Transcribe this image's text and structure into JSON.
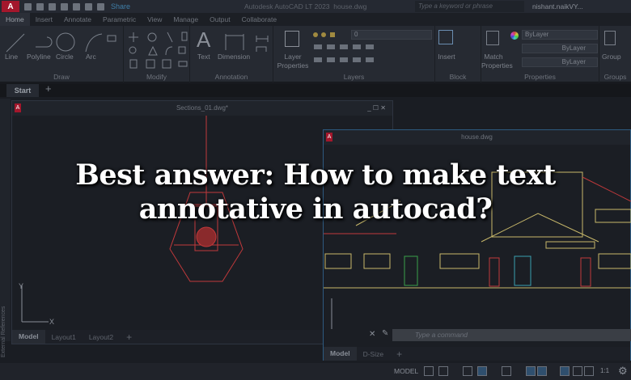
{
  "titlebar": {
    "logo": "A",
    "logo_badge": "LT",
    "share": "Share",
    "app_title": "Autodesk AutoCAD LT 2023",
    "file": "house.dwg",
    "search_placeholder": "Type a keyword or phrase",
    "user": "nishant.naikVY..."
  },
  "ribbon_tabs": [
    "Home",
    "Insert",
    "Annotate",
    "Parametric",
    "View",
    "Manage",
    "Output",
    "Collaborate"
  ],
  "panels": {
    "draw": {
      "label": "Draw",
      "tools": [
        "Line",
        "Polyline",
        "Circle",
        "Arc"
      ]
    },
    "modify": {
      "label": "Modify"
    },
    "annotation": {
      "label": "Annotation",
      "tools": [
        "Text",
        "Dimension"
      ]
    },
    "layers": {
      "label": "Layers",
      "tool": "Layer Properties",
      "layer_value": "0"
    },
    "block": {
      "label": "Block",
      "tool": "Insert"
    },
    "properties": {
      "label": "Properties",
      "tool": "Match Properties",
      "color": "ByLayer",
      "linetype": "ByLayer",
      "lineweight": "ByLayer"
    },
    "groups": {
      "label": "Groups",
      "tool": "Group"
    }
  },
  "doc_tabs": {
    "start": "Start"
  },
  "windows": {
    "sections": {
      "title": "Sections_01.dwg*",
      "palette": "External References",
      "layout_tabs": [
        "Model",
        "Layout1",
        "Layout2"
      ]
    },
    "house": {
      "title": "house.dwg",
      "layout_tabs": [
        "Model",
        "D-Size"
      ]
    }
  },
  "command": {
    "placeholder": "Type a command"
  },
  "status": {
    "model": "MODEL",
    "scale": "1:1"
  },
  "overlay": {
    "line1": "Best answer: How to make text",
    "line2": "annotative in autocad?"
  },
  "colors": {
    "accent": "#a3172c",
    "drawing_red": "#c0393b"
  }
}
